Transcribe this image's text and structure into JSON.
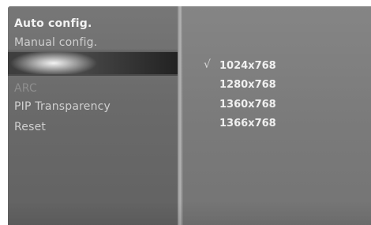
{
  "menu": {
    "items": [
      {
        "label": "Auto config."
      },
      {
        "label": "Manual config."
      },
      {
        "label": ""
      },
      {
        "label": "ARC"
      },
      {
        "label": "PIP Transparency"
      },
      {
        "label": "Reset"
      }
    ]
  },
  "submenu": {
    "check_glyph": "√",
    "options": [
      {
        "label": "1024x768",
        "selected": true
      },
      {
        "label": "1280x768",
        "selected": false
      },
      {
        "label": "1360x768",
        "selected": false
      },
      {
        "label": "1366x768",
        "selected": false
      }
    ]
  }
}
